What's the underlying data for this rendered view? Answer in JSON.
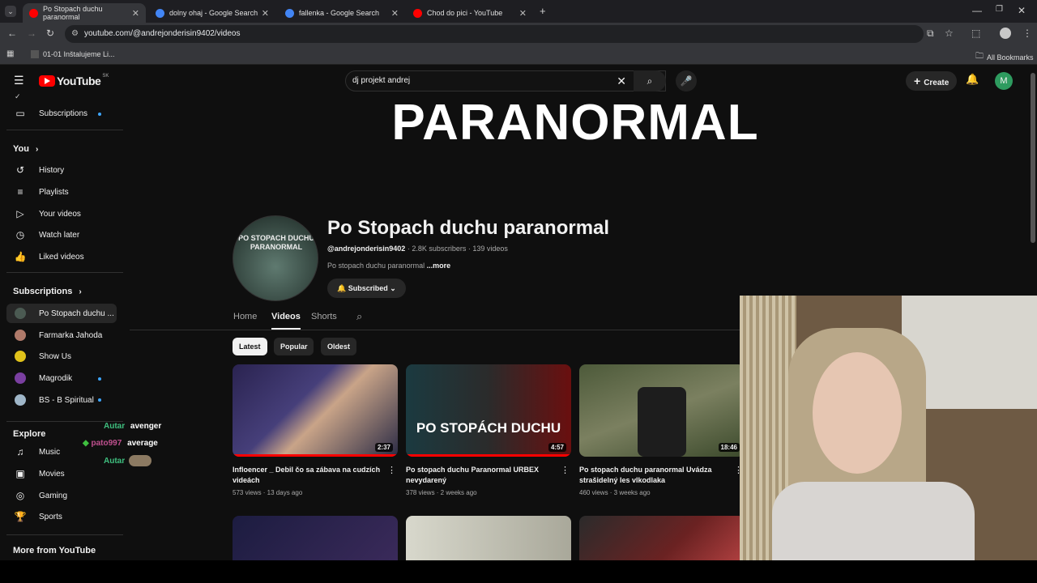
{
  "browser": {
    "tabs": [
      {
        "title": "Po Stopach duchu paranormal",
        "color": "#ff0000"
      },
      {
        "title": "dolny ohaj - Google Search",
        "color": "#4285f4"
      },
      {
        "title": "fallenka - Google Search",
        "color": "#4285f4"
      },
      {
        "title": "Chod do pici - YouTube",
        "color": "#ff0000"
      }
    ],
    "url": "youtube.com/@andrejonderisin9402/videos",
    "bookmark": "01-01 Inštalujeme Li...",
    "all_bookmarks": "All Bookmarks"
  },
  "header": {
    "logo": "YouTube",
    "region": "SK",
    "search_value": "dj projekt andrej",
    "create_label": "Create",
    "avatar_letter": "M"
  },
  "sidebar": {
    "top_items": [
      {
        "label": "Subscriptions",
        "icon": "subscriptions-icon"
      }
    ],
    "you_heading": "You",
    "you_items": [
      {
        "label": "History",
        "icon": "history-icon"
      },
      {
        "label": "Playlists",
        "icon": "playlists-icon"
      },
      {
        "label": "Your videos",
        "icon": "your-videos-icon"
      },
      {
        "label": "Watch later",
        "icon": "clock-icon"
      },
      {
        "label": "Liked videos",
        "icon": "thumbs-up-icon"
      }
    ],
    "subs_heading": "Subscriptions",
    "subs": [
      {
        "label": "Po Stopach duchu ..."
      },
      {
        "label": "Farmarka Jahoda"
      },
      {
        "label": "Show Us"
      },
      {
        "label": "Magrodik"
      },
      {
        "label": "BS - B Spiritual"
      }
    ],
    "explore_heading": "Explore",
    "explore_items": [
      {
        "label": "Music",
        "icon": "music-icon"
      },
      {
        "label": "Movies",
        "icon": "movies-icon"
      },
      {
        "label": "Gaming",
        "icon": "gaming-icon"
      },
      {
        "label": "Sports",
        "icon": "trophy-icon"
      }
    ],
    "more_heading": "More from YouTube"
  },
  "channel": {
    "banner_text": "PARANORMAL",
    "avatar_text": "PO STOPACH DUCHU PARANORMAL",
    "name": "Po Stopach duchu paranormal",
    "handle": "@andrejonderisin9402",
    "stats": "· 2.8K subscribers · 139 videos",
    "description": "Po stopach duchu paranormal",
    "more": "...more",
    "subscribed_label": "Subscribed",
    "tabs": [
      "Home",
      "Videos",
      "Shorts"
    ],
    "filters": [
      "Latest",
      "Popular",
      "Oldest"
    ]
  },
  "videos": [
    {
      "title": "Infloencer _ Debil čo sa zábava na cudzích videách",
      "meta": "573 views · 13 days ago",
      "duration": "2:37",
      "thumb_overlay": ""
    },
    {
      "title": "Po stopach duchu Paranormal URBEX nevydarený",
      "meta": "378 views · 2 weeks ago",
      "duration": "4:57",
      "thumb_overlay": "PO STOPÁCH DUCHU"
    },
    {
      "title": "Po stopach duchu paranormal Uvádza strašidelný les vlkodlaka",
      "meta": "460 views · 3 weeks ago",
      "duration": "18:46",
      "thumb_overlay": ""
    }
  ],
  "chat": [
    {
      "user": "Autar",
      "text": "avenger",
      "color": "#3fbf7f"
    },
    {
      "user": "pato997",
      "text": "average",
      "color": "#c0508f"
    },
    {
      "user": "Autar",
      "text": "",
      "color": "#3fbf7f"
    }
  ]
}
